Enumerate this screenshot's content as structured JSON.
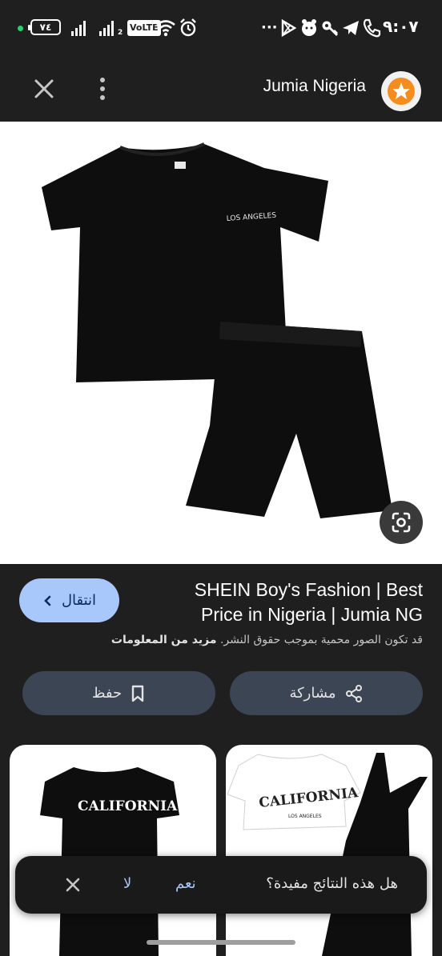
{
  "status_bar": {
    "battery": "٧٤",
    "network_sub": "2",
    "volte": "VoLTE",
    "time": "٩:٠٧",
    "more": "···"
  },
  "app_bar": {
    "title": "Jumia Nigeria"
  },
  "image": {
    "print_text": "LOS ANGELES"
  },
  "result": {
    "visit_label": "انتقال",
    "title": "SHEIN Boy's Fashion | Best Price in Nigeria | Jumia NG",
    "copyright_text": "قد تكون الصور محمية بموجب حقوق النشر.",
    "more_info": "مزيد من المعلومات"
  },
  "actions": {
    "save_label": "حفظ",
    "share_label": "مشاركة"
  },
  "related": [
    {
      "print_text": "CALIFORNIA"
    },
    {
      "print_text": "CALIFORNIA",
      "sub_text": "LOS ANGELES"
    }
  ],
  "feedback": {
    "question": "هل هذه النتائج مفيدة؟",
    "yes": "نعم",
    "no": "لا"
  },
  "colors": {
    "background": "#1f1f1f",
    "accent": "#a8c7fa",
    "pill": "#3c4554",
    "badge": "#f68b1e"
  }
}
